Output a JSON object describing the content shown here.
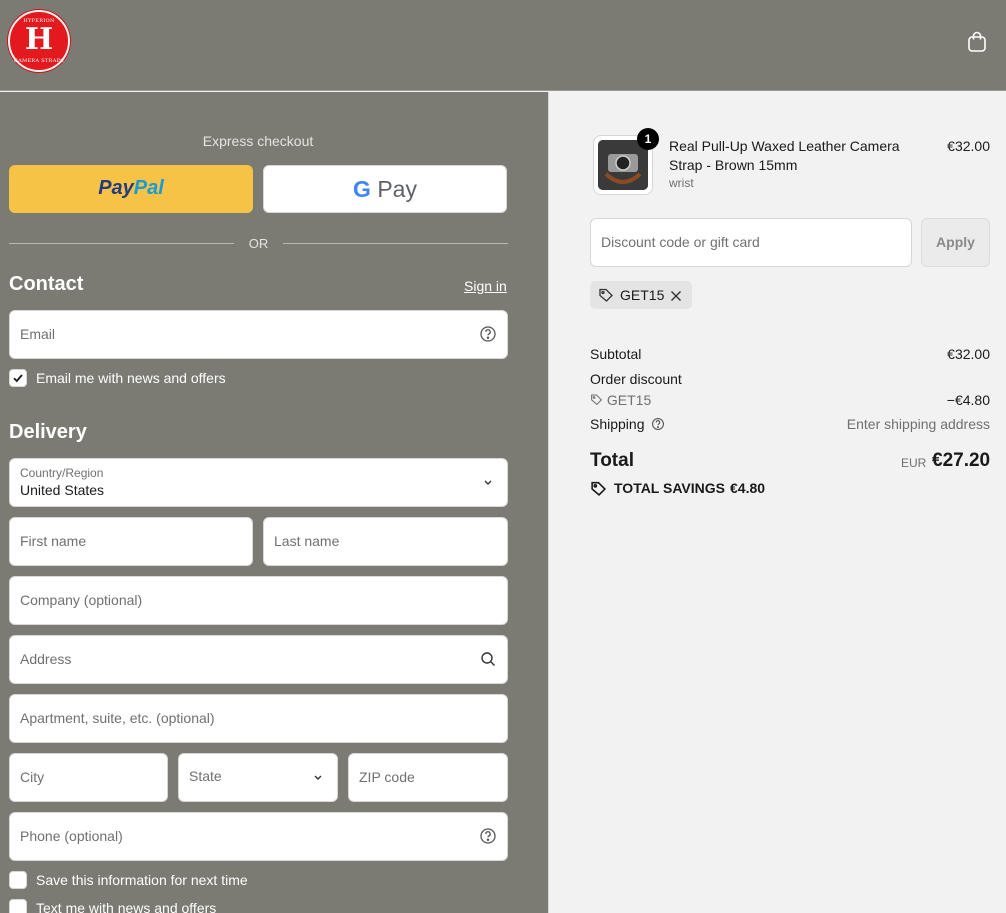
{
  "header": {
    "logo": {
      "top_text": "HYPERION",
      "letter": "H",
      "bottom_text": "CAMERA STRAPS"
    },
    "cart_icon": "shopping-bag-icon"
  },
  "express": {
    "title": "Express checkout",
    "paypal_label_1": "Pay",
    "paypal_label_2": "Pal",
    "gpay_label_g": "G",
    "gpay_label_pay": "Pay",
    "or_label": "OR"
  },
  "contact": {
    "heading": "Contact",
    "sign_in": "Sign in",
    "email_placeholder": "Email",
    "newsletter_label": "Email me with news and offers",
    "newsletter_checked": true
  },
  "delivery": {
    "heading": "Delivery",
    "country_label": "Country/Region",
    "country_value": "United States",
    "first_name": "First name",
    "last_name": "Last name",
    "company": "Company (optional)",
    "address": "Address",
    "apartment": "Apartment, suite, etc. (optional)",
    "city": "City",
    "state": "State",
    "zip": "ZIP code",
    "phone": "Phone (optional)",
    "save_info": "Save this information for next time",
    "text_me": "Text me with news and offers"
  },
  "summary": {
    "product": {
      "qty": "1",
      "name": "Real Pull-Up Waxed Leather Camera Strap - Brown 15mm",
      "variant": "wrist",
      "price": "€32.00"
    },
    "discount_placeholder": "Discount code or gift card",
    "apply_label": "Apply",
    "applied_code": "GET15",
    "subtotal_label": "Subtotal",
    "subtotal_value": "€32.00",
    "order_discount_label": "Order discount",
    "discount_code": "GET15",
    "discount_value": "−€4.80",
    "shipping_label": "Shipping",
    "shipping_value": "Enter shipping address",
    "total_label": "Total",
    "currency": "EUR",
    "total_value": "€27.20",
    "savings_label": "TOTAL SAVINGS",
    "savings_value": "€4.80"
  },
  "colors": {
    "panel_left": "#7b7b73",
    "panel_right": "#f2f2f2",
    "paypal_yellow": "#f7c347",
    "logo_red": "#e3191e"
  }
}
